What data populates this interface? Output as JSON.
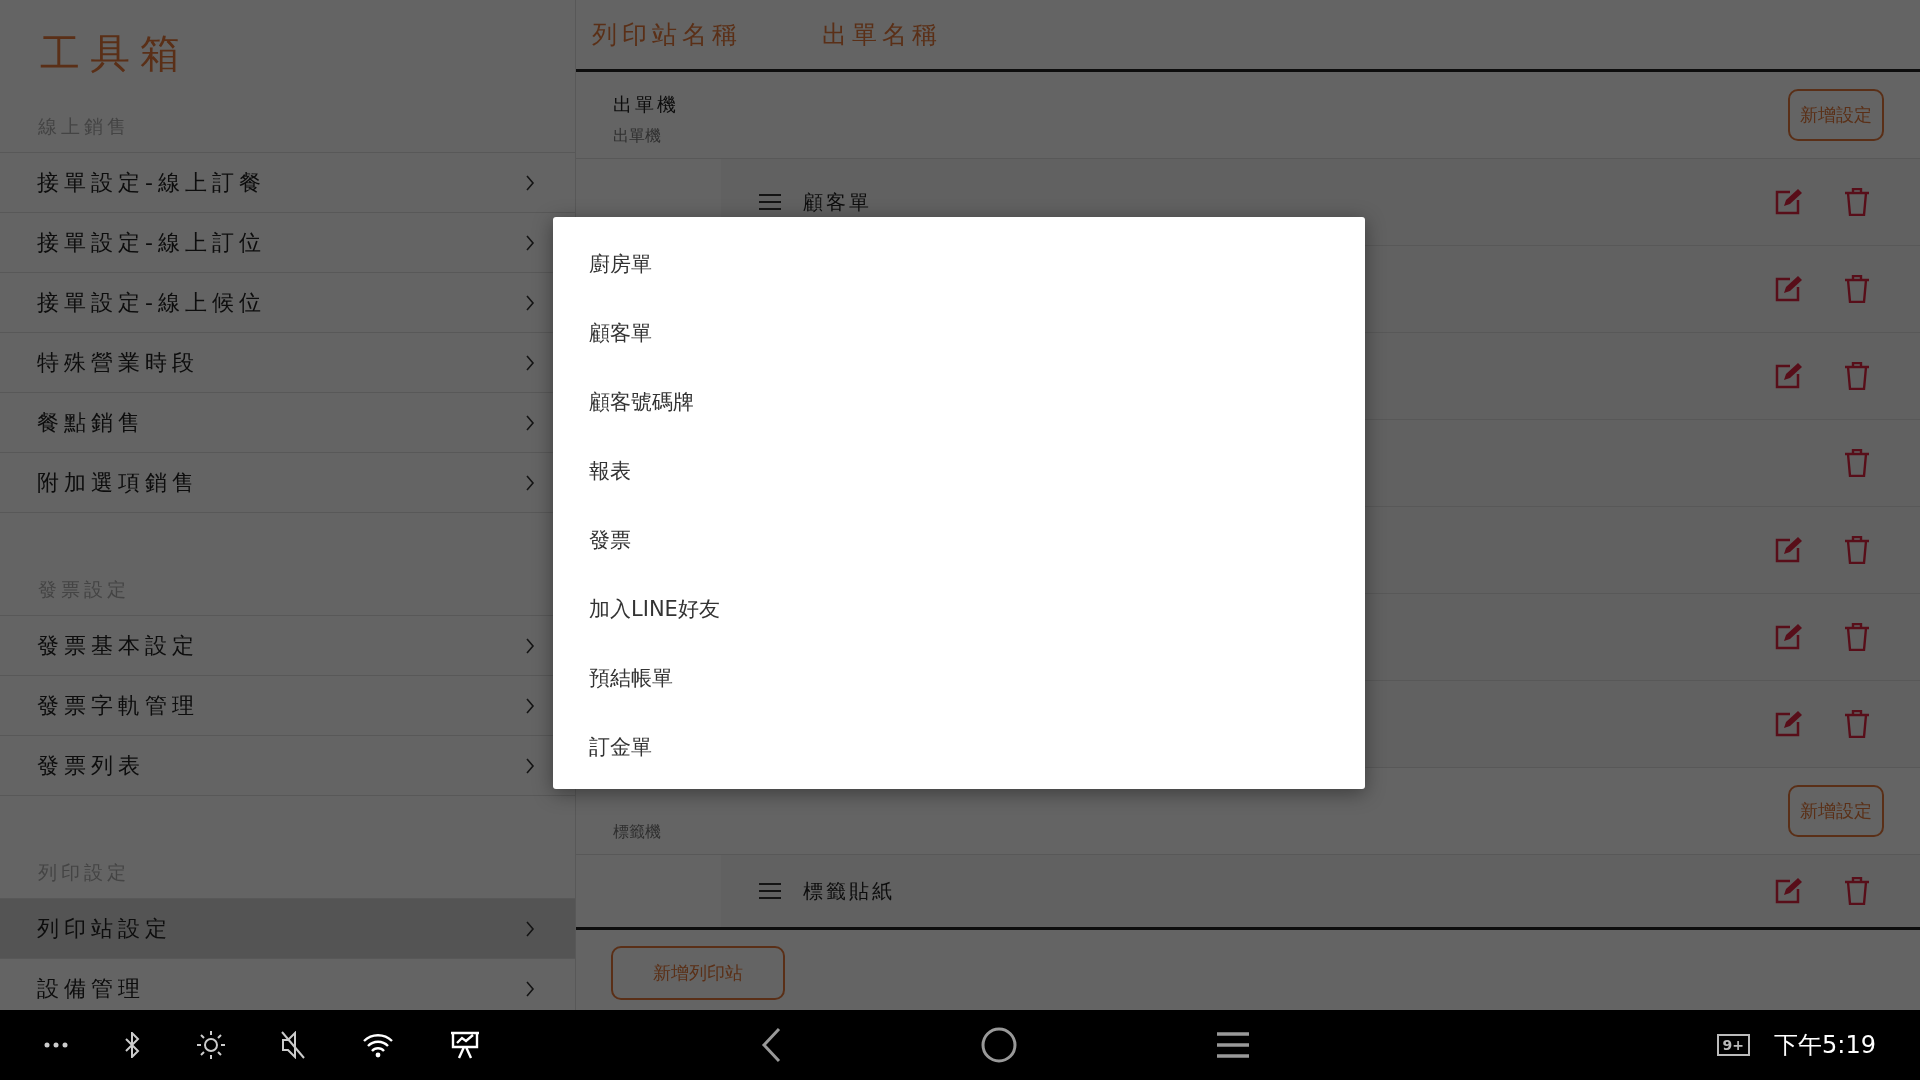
{
  "sidebar": {
    "title": "工具箱",
    "sections": [
      {
        "heading": "線上銷售",
        "items": [
          {
            "label": "接單設定-線上訂餐",
            "selected": false
          },
          {
            "label": "接單設定-線上訂位",
            "selected": false
          },
          {
            "label": "接單設定-線上候位",
            "selected": false
          },
          {
            "label": "特殊營業時段",
            "selected": false
          },
          {
            "label": "餐點銷售",
            "selected": false
          },
          {
            "label": "附加選項銷售",
            "selected": false
          }
        ]
      },
      {
        "heading": "發票設定",
        "items": [
          {
            "label": "發票基本設定",
            "selected": false
          },
          {
            "label": "發票字軌管理",
            "selected": false
          },
          {
            "label": "發票列表",
            "selected": false
          }
        ]
      },
      {
        "heading": "列印設定",
        "items": [
          {
            "label": "列印站設定",
            "selected": true
          },
          {
            "label": "設備管理",
            "selected": false
          }
        ]
      }
    ]
  },
  "table": {
    "columns": [
      "列印站名稱",
      "出單名稱"
    ],
    "groups": [
      {
        "name": "出單機",
        "subtitle": "出單機",
        "add_button": "新增設定",
        "items": [
          {
            "name": "顧客單",
            "editable": true
          },
          {
            "editable": true
          },
          {
            "editable": true
          },
          {
            "editable": false
          },
          {
            "editable": true
          },
          {
            "editable": true
          },
          {
            "editable": true
          }
        ]
      },
      {
        "subtitle": "標籤機",
        "add_button": "新增設定",
        "items": [
          {
            "name": "標籤貼紙",
            "editable": true
          }
        ]
      }
    ],
    "add_station_button": "新增列印站"
  },
  "dialog": {
    "options": [
      "廚房單",
      "顧客單",
      "顧客號碼牌",
      "報表",
      "發票",
      "加入LINE好友",
      "預結帳單",
      "訂金單"
    ]
  },
  "status_bar": {
    "notification_count": "9+",
    "time": "下午5:19"
  }
}
